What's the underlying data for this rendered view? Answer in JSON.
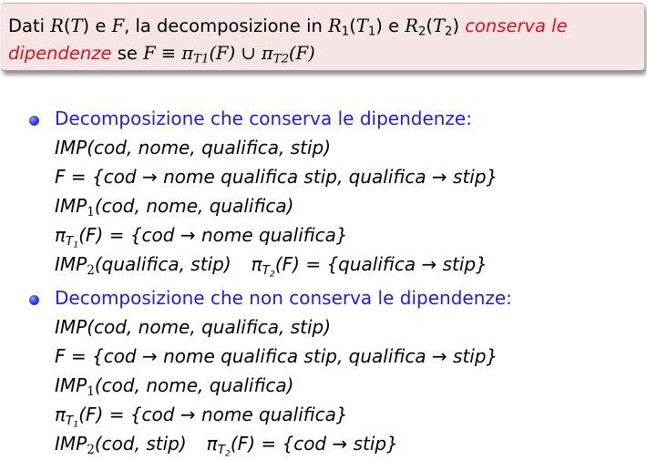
{
  "definition": {
    "line1": {
      "p1": "Dati ",
      "R": "R",
      "paren_open": "(",
      "T": "T",
      "paren_close": ")",
      "p2": " e ",
      "F": "F",
      "p3": ", la decomposizione in ",
      "R1": "R",
      "R1_sub": "1",
      "T1_open": "(",
      "T1": "T",
      "T1_sub": "1",
      "T1_close": ")",
      "p4": " e ",
      "R2": "R",
      "R2_sub": "2",
      "T2_open": "(",
      "T2": "T",
      "T2_sub": "2",
      "T2_close": ")",
      "highlight": " conserva le"
    },
    "line2": {
      "highlight": "dipendenze",
      "p1": " se ",
      "formula": "F ≡ π",
      "sub1": "T1",
      "mid": "(F) ∪ π",
      "sub2": "T2",
      "end": "(F)"
    }
  },
  "section1": {
    "heading": "Decomposizione che conserva le dipendenze:",
    "relation": "IMP(cod, nome, qualifica, stip)",
    "fds": "F = {cod → nome qualifica stip, qualifica → stip}",
    "r1_name": "IMP",
    "r1_sub": "1",
    "r1_attrs": "(cod, nome, qualifica)",
    "proj1_pi": "π",
    "proj1_T": "T",
    "proj1_Tsub": "1",
    "proj1_rest": "(F) = {cod → nome qualifica}",
    "r2_name": "IMP",
    "r2_sub": "2",
    "r2_attrs": "(qualifica, stip)",
    "proj2_pi": "π",
    "proj2_T": "T",
    "proj2_Tsub": "2",
    "proj2_rest": "(F) = {qualifica → stip}"
  },
  "section2": {
    "heading": "Decomposizione che non conserva le dipendenze:",
    "relation": "IMP(cod, nome, qualifica, stip)",
    "fds": "F = {cod → nome qualifica stip, qualifica → stip}",
    "r1_name": "IMP",
    "r1_sub": "1",
    "r1_attrs": "(cod, nome, qualifica)",
    "proj1_pi": "π",
    "proj1_T": "T",
    "proj1_Tsub": "1",
    "proj1_rest": "(F) = {cod → nome qualifica}",
    "r2_name": "IMP",
    "r2_sub": "2",
    "r2_attrs": "(cod, stip)",
    "proj2_pi": "π",
    "proj2_T": "T",
    "proj2_Tsub": "2",
    "proj2_rest": "(F) = {cod → stip}"
  },
  "colors": {
    "highlight": "#e0101a",
    "heading": "#1d1de2",
    "box_background": "#f6e5e5"
  }
}
